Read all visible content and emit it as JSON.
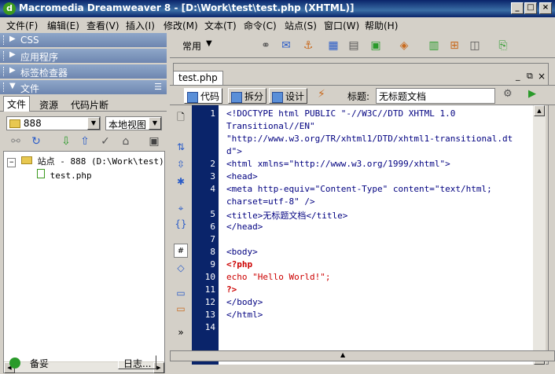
{
  "window": {
    "title": "Macromedia Dreamweaver 8 - [D:\\Work\\test\\test.php (XHTML)]",
    "min": "_",
    "max": "□",
    "close": "×"
  },
  "menu": [
    "文件(F)",
    "编辑(E)",
    "查看(V)",
    "插入(I)",
    "修改(M)",
    "文本(T)",
    "命令(C)",
    "站点(S)",
    "窗口(W)",
    "帮助(H)"
  ],
  "panels": {
    "css": "CSS",
    "app": "应用程序",
    "tag_inspector": "标签检查器",
    "files": "文件"
  },
  "files_tabs": [
    "文件",
    "资源",
    "代码片断"
  ],
  "site_select": "888",
  "view_select": "本地视图",
  "tree": {
    "site": "站点 - 888 (D:\\Work\\test)",
    "file": "test.php"
  },
  "left_status": {
    "ready": "备妥",
    "log": "日志..."
  },
  "insert_bar": {
    "category": "常用"
  },
  "document": {
    "tab": "test.php",
    "code_btn": "代码",
    "split_btn": "拆分",
    "design_btn": "设计",
    "title_label": "标题:",
    "title_value": "无标题文档"
  },
  "line_numbers": [
    "1",
    "2",
    "3",
    "4",
    "5",
    "6",
    "7",
    "8",
    "9",
    "10",
    "11",
    "12",
    "13",
    "14"
  ],
  "code_lines": [
    "<!DOCTYPE html PUBLIC \"-//W3C//DTD XHTML 1.0",
    "Transitional//EN\"",
    "\"http://www.w3.org/TR/xhtml1/DTD/xhtml1-transitional.dt",
    "d\">",
    "<html xmlns=\"http://www.w3.org/1999/xhtml\">",
    "<head>",
    "<meta http-equiv=\"Content-Type\" content=\"text/html;",
    "charset=utf-8\" />",
    "<title>无标题文档</title>",
    "</head>",
    "",
    "<body>",
    "<?php",
    "    echo \"Hello World!\";",
    "?>",
    "</body>",
    "</html>",
    ""
  ]
}
